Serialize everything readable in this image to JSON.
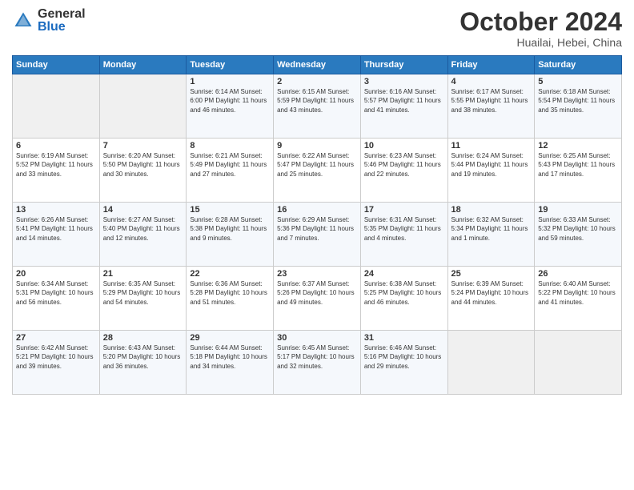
{
  "header": {
    "logo_general": "General",
    "logo_blue": "Blue",
    "month_title": "October 2024",
    "subtitle": "Huailai, Hebei, China"
  },
  "days_of_week": [
    "Sunday",
    "Monday",
    "Tuesday",
    "Wednesday",
    "Thursday",
    "Friday",
    "Saturday"
  ],
  "weeks": [
    [
      {
        "day": "",
        "content": ""
      },
      {
        "day": "",
        "content": ""
      },
      {
        "day": "1",
        "content": "Sunrise: 6:14 AM\nSunset: 6:00 PM\nDaylight: 11 hours and 46 minutes."
      },
      {
        "day": "2",
        "content": "Sunrise: 6:15 AM\nSunset: 5:59 PM\nDaylight: 11 hours and 43 minutes."
      },
      {
        "day": "3",
        "content": "Sunrise: 6:16 AM\nSunset: 5:57 PM\nDaylight: 11 hours and 41 minutes."
      },
      {
        "day": "4",
        "content": "Sunrise: 6:17 AM\nSunset: 5:55 PM\nDaylight: 11 hours and 38 minutes."
      },
      {
        "day": "5",
        "content": "Sunrise: 6:18 AM\nSunset: 5:54 PM\nDaylight: 11 hours and 35 minutes."
      }
    ],
    [
      {
        "day": "6",
        "content": "Sunrise: 6:19 AM\nSunset: 5:52 PM\nDaylight: 11 hours and 33 minutes."
      },
      {
        "day": "7",
        "content": "Sunrise: 6:20 AM\nSunset: 5:50 PM\nDaylight: 11 hours and 30 minutes."
      },
      {
        "day": "8",
        "content": "Sunrise: 6:21 AM\nSunset: 5:49 PM\nDaylight: 11 hours and 27 minutes."
      },
      {
        "day": "9",
        "content": "Sunrise: 6:22 AM\nSunset: 5:47 PM\nDaylight: 11 hours and 25 minutes."
      },
      {
        "day": "10",
        "content": "Sunrise: 6:23 AM\nSunset: 5:46 PM\nDaylight: 11 hours and 22 minutes."
      },
      {
        "day": "11",
        "content": "Sunrise: 6:24 AM\nSunset: 5:44 PM\nDaylight: 11 hours and 19 minutes."
      },
      {
        "day": "12",
        "content": "Sunrise: 6:25 AM\nSunset: 5:43 PM\nDaylight: 11 hours and 17 minutes."
      }
    ],
    [
      {
        "day": "13",
        "content": "Sunrise: 6:26 AM\nSunset: 5:41 PM\nDaylight: 11 hours and 14 minutes."
      },
      {
        "day": "14",
        "content": "Sunrise: 6:27 AM\nSunset: 5:40 PM\nDaylight: 11 hours and 12 minutes."
      },
      {
        "day": "15",
        "content": "Sunrise: 6:28 AM\nSunset: 5:38 PM\nDaylight: 11 hours and 9 minutes."
      },
      {
        "day": "16",
        "content": "Sunrise: 6:29 AM\nSunset: 5:36 PM\nDaylight: 11 hours and 7 minutes."
      },
      {
        "day": "17",
        "content": "Sunrise: 6:31 AM\nSunset: 5:35 PM\nDaylight: 11 hours and 4 minutes."
      },
      {
        "day": "18",
        "content": "Sunrise: 6:32 AM\nSunset: 5:34 PM\nDaylight: 11 hours and 1 minute."
      },
      {
        "day": "19",
        "content": "Sunrise: 6:33 AM\nSunset: 5:32 PM\nDaylight: 10 hours and 59 minutes."
      }
    ],
    [
      {
        "day": "20",
        "content": "Sunrise: 6:34 AM\nSunset: 5:31 PM\nDaylight: 10 hours and 56 minutes."
      },
      {
        "day": "21",
        "content": "Sunrise: 6:35 AM\nSunset: 5:29 PM\nDaylight: 10 hours and 54 minutes."
      },
      {
        "day": "22",
        "content": "Sunrise: 6:36 AM\nSunset: 5:28 PM\nDaylight: 10 hours and 51 minutes."
      },
      {
        "day": "23",
        "content": "Sunrise: 6:37 AM\nSunset: 5:26 PM\nDaylight: 10 hours and 49 minutes."
      },
      {
        "day": "24",
        "content": "Sunrise: 6:38 AM\nSunset: 5:25 PM\nDaylight: 10 hours and 46 minutes."
      },
      {
        "day": "25",
        "content": "Sunrise: 6:39 AM\nSunset: 5:24 PM\nDaylight: 10 hours and 44 minutes."
      },
      {
        "day": "26",
        "content": "Sunrise: 6:40 AM\nSunset: 5:22 PM\nDaylight: 10 hours and 41 minutes."
      }
    ],
    [
      {
        "day": "27",
        "content": "Sunrise: 6:42 AM\nSunset: 5:21 PM\nDaylight: 10 hours and 39 minutes."
      },
      {
        "day": "28",
        "content": "Sunrise: 6:43 AM\nSunset: 5:20 PM\nDaylight: 10 hours and 36 minutes."
      },
      {
        "day": "29",
        "content": "Sunrise: 6:44 AM\nSunset: 5:18 PM\nDaylight: 10 hours and 34 minutes."
      },
      {
        "day": "30",
        "content": "Sunrise: 6:45 AM\nSunset: 5:17 PM\nDaylight: 10 hours and 32 minutes."
      },
      {
        "day": "31",
        "content": "Sunrise: 6:46 AM\nSunset: 5:16 PM\nDaylight: 10 hours and 29 minutes."
      },
      {
        "day": "",
        "content": ""
      },
      {
        "day": "",
        "content": ""
      }
    ]
  ]
}
